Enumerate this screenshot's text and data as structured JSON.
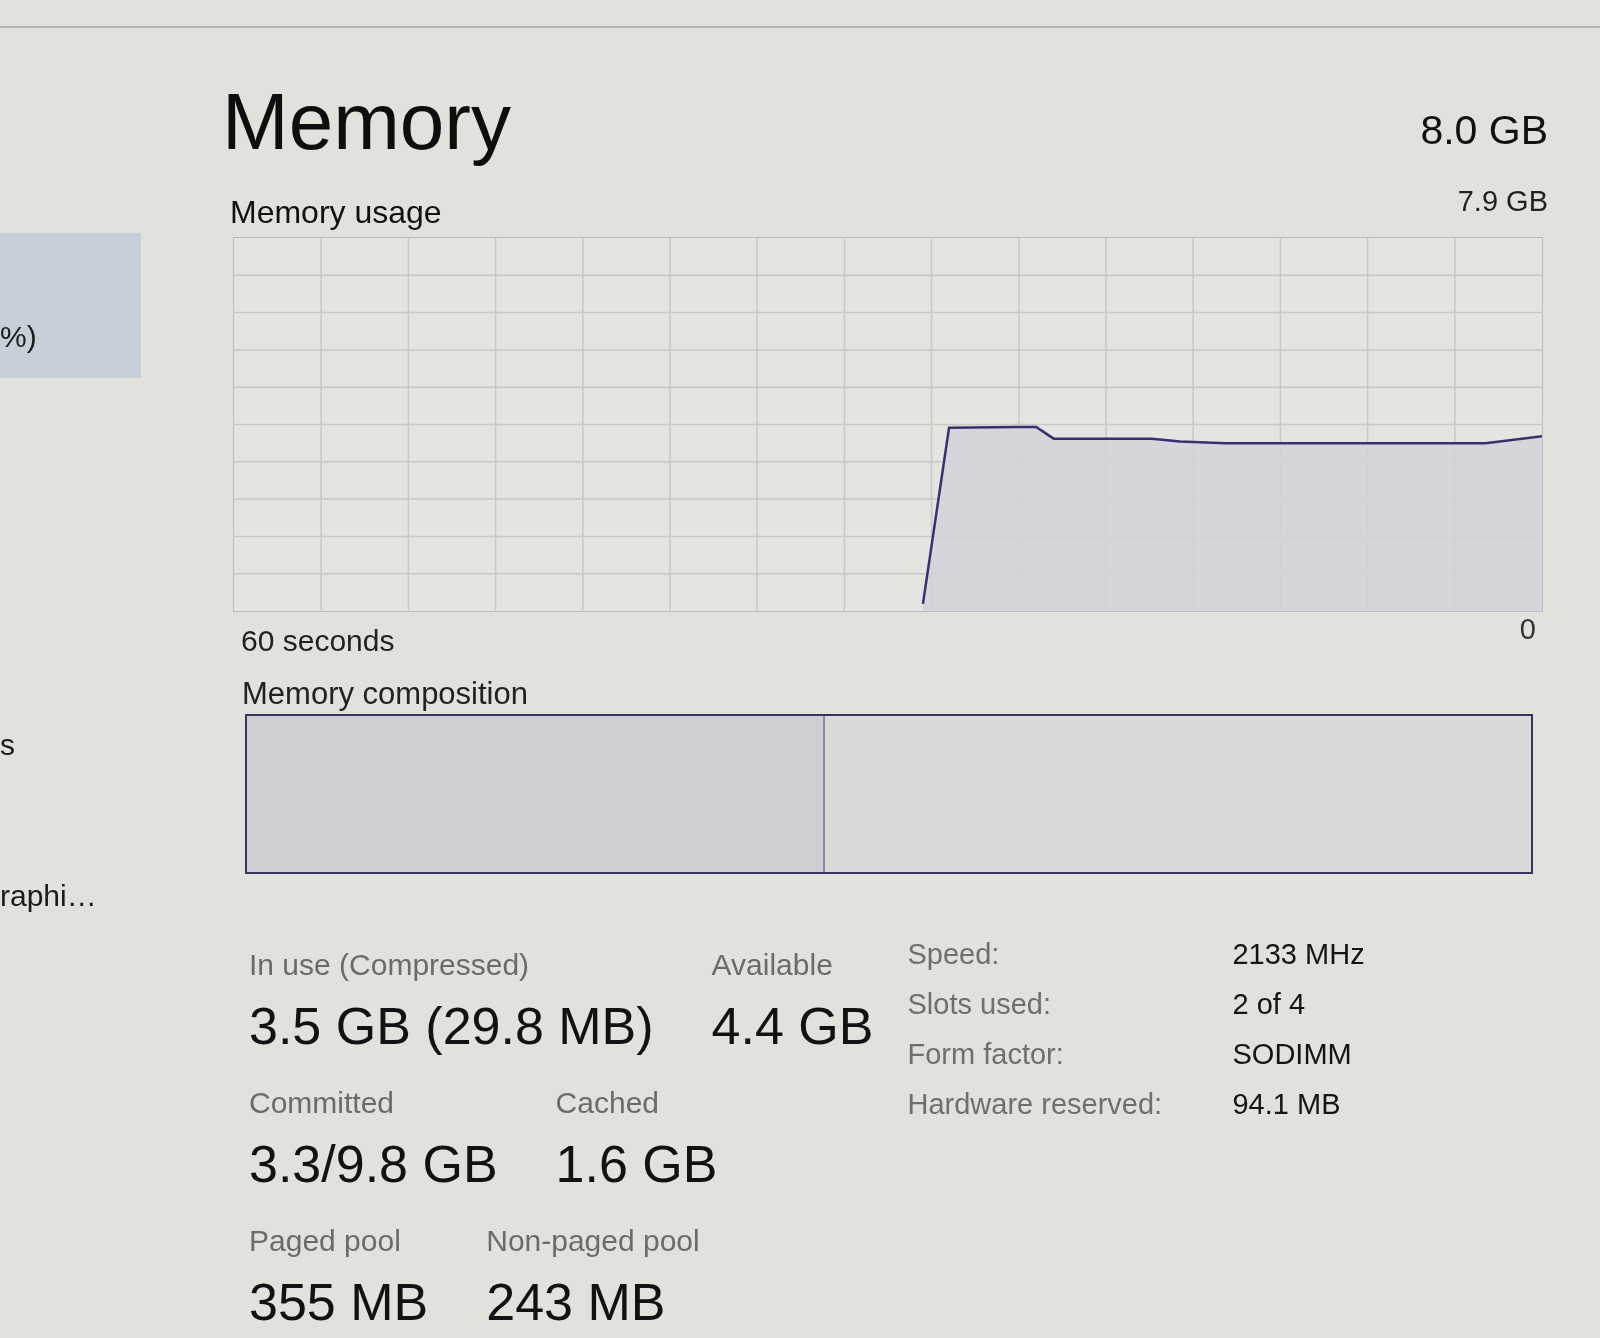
{
  "sidebar": {
    "items": [
      {
        "text": "%)",
        "selected": true
      },
      {
        "text": "s",
        "selected": false
      },
      {
        "text": "raphi…",
        "selected": false
      }
    ]
  },
  "header": {
    "title": "Memory",
    "capacity": "8.0 GB"
  },
  "usage_graph": {
    "title": "Memory usage",
    "max_label": "7.9 GB",
    "time_span": "60 seconds",
    "min_label": "0"
  },
  "composition": {
    "label": "Memory composition",
    "level": 0.45
  },
  "stats": [
    [
      {
        "label": "In use (Compressed)",
        "value": "3.5 GB (29.8 MB)"
      },
      {
        "label": "Available",
        "value": "4.4 GB"
      }
    ],
    [
      {
        "label": "Committed",
        "value": "3.3/9.8 GB"
      },
      {
        "label": "Cached",
        "value": "1.6 GB"
      }
    ],
    [
      {
        "label": "Paged pool",
        "value": "355 MB"
      },
      {
        "label": "Non-paged pool",
        "value": "243 MB"
      }
    ]
  ],
  "hardware": [
    {
      "label": "Speed:",
      "value": "2133 MHz"
    },
    {
      "label": "Slots used:",
      "value": "2 of 4"
    },
    {
      "label": "Form factor:",
      "value": "SODIMM"
    },
    {
      "label": "Hardware reserved:",
      "value": "94.1 MB"
    }
  ]
}
